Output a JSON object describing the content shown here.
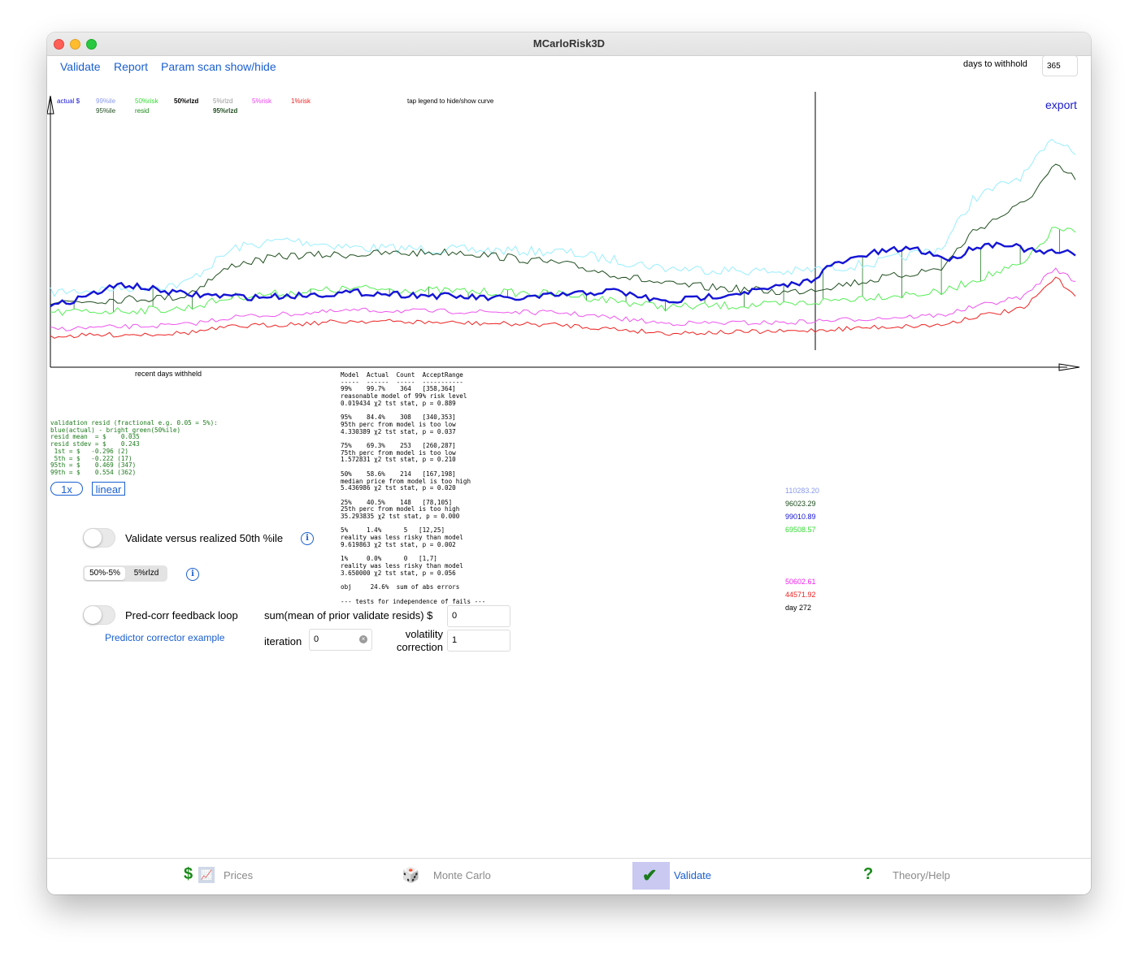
{
  "window": {
    "title": "MCarloRisk3D"
  },
  "nav": {
    "validate": "Validate",
    "report": "Report",
    "param_scan": "Param scan show/hide"
  },
  "withhold": {
    "label": "days to withhold",
    "value": "365"
  },
  "export_label": "export",
  "legend": {
    "actual": "actual $",
    "p99": "99%ile",
    "p95": "95%ile",
    "risk50": "50%risk",
    "resid": "resid",
    "rlzd50": "50%rlzd",
    "rlzd5": "5%rlzd",
    "rlzd95": "95%rlzd",
    "risk5": "5%risk",
    "risk1": "1%risk",
    "hint": "tap legend to hide/show curve"
  },
  "colors": {
    "actual": "#1414d6",
    "p99": "#99eeff",
    "p95": "#1e4d1e",
    "risk50": "#55ee55",
    "risk5": "#ee55ee",
    "risk1": "#ee2222"
  },
  "axis": {
    "xlabel": "recent days withheld"
  },
  "stats_text": "Model  Actual  Count  AcceptRange\n-----  ------  -----  -----------\n99%    99.7%    364   [358,364]\nreasonable model of 99% risk level\n0.019434 χ2 tst stat, p = 0.889\n\n95%    84.4%    308   [340,353]\n95th perc from model is too low\n4.330389 χ2 tst stat, p = 0.037\n\n75%    69.3%    253   [260,287]\n75th perc from model is too low\n1.572831 χ2 tst stat, p = 0.210\n\n50%    58.6%    214   [167,198]\nmedian price from model is too high\n5.436986 χ2 tst stat, p = 0.020\n\n25%    40.5%    148   [78,105]\n25th perc from model is too high\n35.293835 χ2 tst stat, p = 0.000\n\n5%     1.4%      5   [12,25]\nreality was less risky than model\n9.619863 χ2 tst stat, p = 0.002\n\n1%     0.0%      0   [1,7]\nreality was less risky than model\n3.650000 χ2 tst stat, p = 0.056\n\nobj     24.6%  sum of abs errors\n\n--- tests for independence of fails ---",
  "resid_text": "validation resid (fractional e.g. 0.05 = 5%):\nblue(actual) - bright_green(50%ile)\nresid mean  = $    0.035\nresid stdev = $    0.243\n 1st = $   -0.296 (2)\n 5th = $   -0.222 (17)\n95th = $    0.469 (347)\n99th = $    0.554 (362)",
  "scale": {
    "zoom": "1x",
    "mode": "linear"
  },
  "controls": {
    "validate_realized": "Validate versus realized 50th %ile",
    "seg1": "50%-5%",
    "seg2": "5%rlzd",
    "predcorr": "Pred-corr feedback loop",
    "predcorr_example": "Predictor corrector example",
    "sum_label": "sum(mean of prior validate resids) $",
    "sum_value": "0",
    "iteration_label": "iteration",
    "iteration_value": "0",
    "volatility_label1": "volatility",
    "volatility_label2": "correction",
    "volatility_value": "1"
  },
  "cursor_values": {
    "v1": "110283.20",
    "v2": "96023.29",
    "v3": "99010.89",
    "v4": "69508.57",
    "v5": "50602.61",
    "v6": "44571.92",
    "day": "day 272"
  },
  "tabs": {
    "prices": "Prices",
    "montecarlo": "Monte Carlo",
    "validate": "Validate",
    "help": "Theory/Help"
  }
}
